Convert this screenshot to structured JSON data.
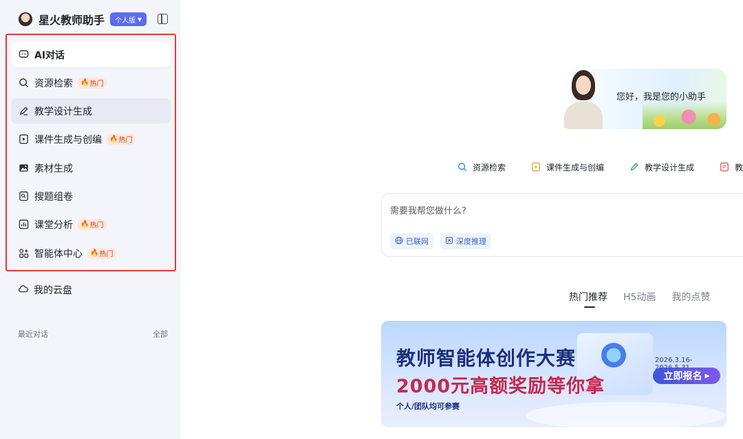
{
  "app": {
    "name": "星火教师助手",
    "edition": "个人版"
  },
  "sidebar": {
    "items": [
      {
        "label": "AI对话",
        "icon": "chat-bubble-icon",
        "hot": false,
        "state": "active"
      },
      {
        "label": "资源检索",
        "icon": "search-refresh-icon",
        "hot": true,
        "state": ""
      },
      {
        "label": "教学设计生成",
        "icon": "pencil-icon",
        "hot": false,
        "state": "hover"
      },
      {
        "label": "课件生成与创编",
        "icon": "slides-icon",
        "hot": true,
        "state": ""
      },
      {
        "label": "素材生成",
        "icon": "image-icon",
        "hot": false,
        "state": ""
      },
      {
        "label": "搜题组卷",
        "icon": "paper-icon",
        "hot": false,
        "state": ""
      },
      {
        "label": "课堂分析",
        "icon": "chart-icon",
        "hot": true,
        "state": ""
      },
      {
        "label": "智能体中心",
        "icon": "agent-grid-icon",
        "hot": true,
        "state": ""
      }
    ],
    "hot_label": "热门",
    "cloud_label": "我的云盘",
    "recent_label": "最近对话",
    "all_label": "全部"
  },
  "main": {
    "greeting": "您好，我是您的小助手",
    "quick_actions": [
      {
        "label": "资源检索",
        "icon": "search-refresh-icon",
        "color": "#3b82f6"
      },
      {
        "label": "课件生成与创编",
        "icon": "slides-icon",
        "color": "#e8a23a"
      },
      {
        "label": "教学设计生成",
        "icon": "pencil-icon",
        "color": "#22a06b"
      },
      {
        "label": "教案",
        "icon": "doc-icon",
        "color": "#e0574f"
      }
    ],
    "input_placeholder": "需要我帮您做什么?",
    "chips": {
      "web": "已联网",
      "deep": "深度推理"
    },
    "tabs": [
      "热门推荐",
      "H5动画",
      "我的点赞"
    ],
    "banner": {
      "title": "教师智能体创作大赛",
      "subtitle": "2000元高额奖励等你拿",
      "note": "个人/团队均可参赛",
      "dates": "2026.3.16-2026.5.31",
      "button": "立即报名"
    }
  }
}
